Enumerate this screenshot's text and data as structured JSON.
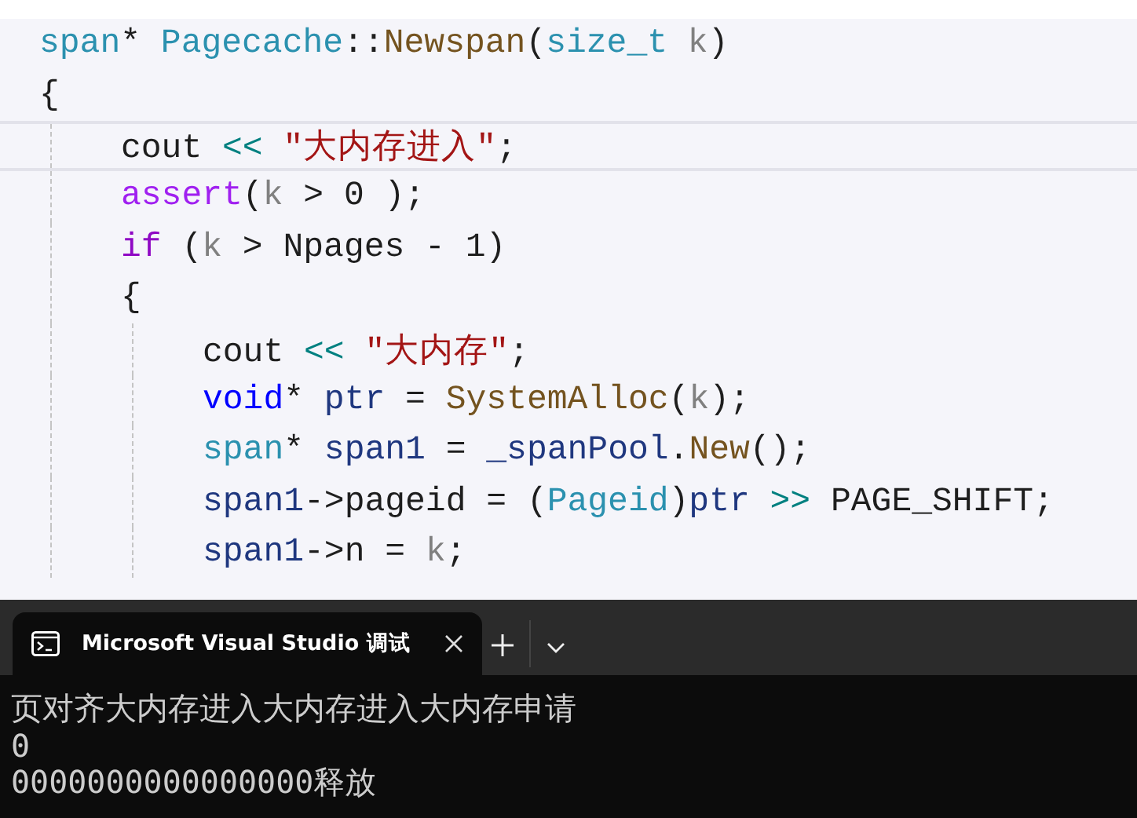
{
  "editor": {
    "lines": [
      {
        "current": false,
        "tokens": [
          {
            "text": "span",
            "kind": "type"
          },
          {
            "text": "* ",
            "kind": "plain"
          },
          {
            "text": "Pagecache",
            "kind": "type"
          },
          {
            "text": "::",
            "kind": "plain"
          },
          {
            "text": "Newspan",
            "kind": "func"
          },
          {
            "text": "(",
            "kind": "plain"
          },
          {
            "text": "size_t ",
            "kind": "type"
          },
          {
            "text": "k",
            "kind": "param"
          },
          {
            "text": ")",
            "kind": "plain"
          }
        ]
      },
      {
        "current": false,
        "tokens": [
          {
            "text": "{",
            "kind": "plain"
          }
        ],
        "children": [
          {
            "current": true,
            "tokens": [
              {
                "text": "cout ",
                "kind": "plain"
              },
              {
                "text": "<< ",
                "kind": "op"
              },
              {
                "text": "\"大内存进入\"",
                "kind": "string"
              },
              {
                "text": ";",
                "kind": "plain"
              }
            ]
          },
          {
            "current": false,
            "tokens": [
              {
                "text": "assert",
                "kind": "macro"
              },
              {
                "text": "(",
                "kind": "plain"
              },
              {
                "text": "k",
                "kind": "param"
              },
              {
                "text": " > 0 );",
                "kind": "plain"
              }
            ]
          },
          {
            "current": false,
            "tokens": [
              {
                "text": "if",
                "kind": "control"
              },
              {
                "text": " (",
                "kind": "plain"
              },
              {
                "text": "k",
                "kind": "param"
              },
              {
                "text": " > Npages - 1)",
                "kind": "plain"
              }
            ]
          },
          {
            "current": false,
            "tokens": [
              {
                "text": "{",
                "kind": "plain"
              }
            ],
            "children": [
              {
                "current": false,
                "tokens": [
                  {
                    "text": "cout ",
                    "kind": "plain"
                  },
                  {
                    "text": "<< ",
                    "kind": "op"
                  },
                  {
                    "text": "\"大内存\"",
                    "kind": "string"
                  },
                  {
                    "text": ";",
                    "kind": "plain"
                  }
                ]
              },
              {
                "current": false,
                "tokens": [
                  {
                    "text": "void",
                    "kind": "keyword"
                  },
                  {
                    "text": "* ",
                    "kind": "plain"
                  },
                  {
                    "text": "ptr",
                    "kind": "local"
                  },
                  {
                    "text": " = ",
                    "kind": "plain"
                  },
                  {
                    "text": "SystemAlloc",
                    "kind": "func"
                  },
                  {
                    "text": "(",
                    "kind": "plain"
                  },
                  {
                    "text": "k",
                    "kind": "param"
                  },
                  {
                    "text": ");",
                    "kind": "plain"
                  }
                ]
              },
              {
                "current": false,
                "tokens": [
                  {
                    "text": "span",
                    "kind": "type"
                  },
                  {
                    "text": "* ",
                    "kind": "plain"
                  },
                  {
                    "text": "span1",
                    "kind": "local"
                  },
                  {
                    "text": " = ",
                    "kind": "plain"
                  },
                  {
                    "text": "_spanPool",
                    "kind": "local"
                  },
                  {
                    "text": ".",
                    "kind": "plain"
                  },
                  {
                    "text": "New",
                    "kind": "func"
                  },
                  {
                    "text": "();",
                    "kind": "plain"
                  }
                ]
              },
              {
                "current": false,
                "tokens": [
                  {
                    "text": "span1",
                    "kind": "local"
                  },
                  {
                    "text": "->pageid = (",
                    "kind": "plain"
                  },
                  {
                    "text": "Pageid",
                    "kind": "type"
                  },
                  {
                    "text": ")",
                    "kind": "plain"
                  },
                  {
                    "text": "ptr ",
                    "kind": "local"
                  },
                  {
                    "text": ">>",
                    "kind": "op"
                  },
                  {
                    "text": " PAGE_SHIFT;",
                    "kind": "plain"
                  }
                ]
              },
              {
                "current": false,
                "tokens": [
                  {
                    "text": "span1",
                    "kind": "local"
                  },
                  {
                    "text": "->n = ",
                    "kind": "plain"
                  },
                  {
                    "text": "k",
                    "kind": "param"
                  },
                  {
                    "text": ";",
                    "kind": "plain"
                  }
                ]
              }
            ]
          }
        ]
      }
    ]
  },
  "terminal": {
    "tabs": [
      {
        "title": "Microsoft Visual Studio 调试",
        "selected": true
      }
    ],
    "output": [
      "页对齐大内存进入大内存进入大内存申请",
      "0",
      "0000000000000000释放"
    ]
  }
}
